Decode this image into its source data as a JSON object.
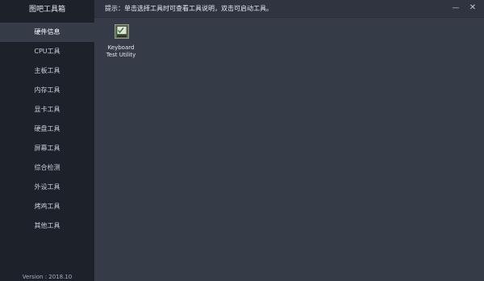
{
  "sidebar": {
    "title": "图吧工具箱",
    "items": [
      {
        "label": "硬件信息",
        "active": true
      },
      {
        "label": "CPU工具"
      },
      {
        "label": "主板工具"
      },
      {
        "label": "内存工具"
      },
      {
        "label": "显卡工具"
      },
      {
        "label": "硬盘工具"
      },
      {
        "label": "屏幕工具"
      },
      {
        "label": "综合检测"
      },
      {
        "label": "外设工具"
      },
      {
        "label": "烤鸡工具"
      },
      {
        "label": "其他工具"
      }
    ],
    "version": "Version : 2018.10"
  },
  "header": {
    "hint": "提示：单击选择工具时可查看工具说明，双击可启动工具。",
    "minimize": "—",
    "close": "✕"
  },
  "tools": [
    {
      "label_line1": "Keyboard",
      "label_line2": "Test Utility",
      "icon": "keyboard-test-icon"
    }
  ],
  "colors": {
    "sidebar_bg": "#1d212a",
    "main_bg": "#363b48",
    "active_item_bg": "#363b48"
  }
}
